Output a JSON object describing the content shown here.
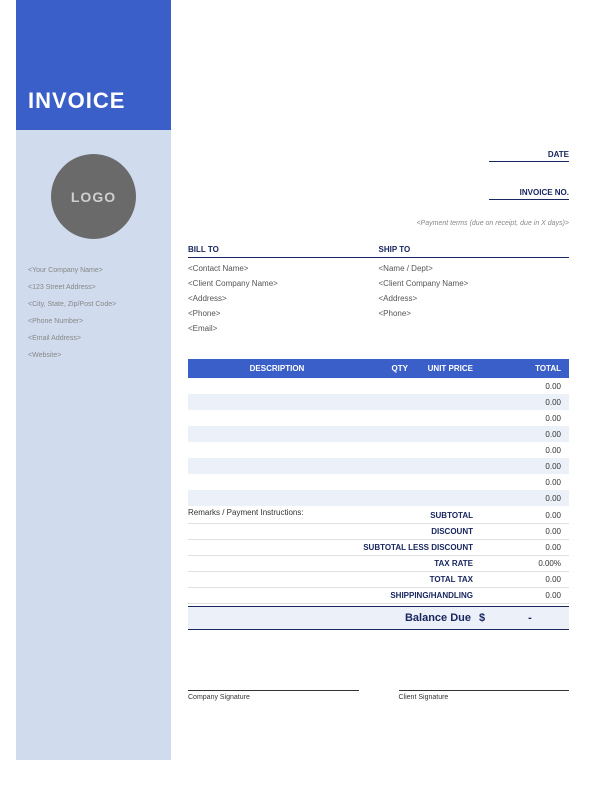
{
  "title": "INVOICE",
  "logo": "LOGO",
  "company": {
    "name": "<Your Company Name>",
    "address": "<123 Street Address>",
    "city": "<City, State, Zip/Post Code>",
    "phone": "<Phone Number>",
    "email": "<Email Address>",
    "website": "<Website>"
  },
  "meta": {
    "date_label": "DATE",
    "invoice_no_label": "INVOICE NO."
  },
  "payment_terms": "<Payment terms (due on receipt, due in X days)>",
  "bill_to": {
    "title": "BILL TO",
    "contact": "<Contact Name>",
    "company": "<Client Company Name>",
    "address": "<Address>",
    "phone": "<Phone>",
    "email": "<Email>"
  },
  "ship_to": {
    "title": "SHIP TO",
    "name": "<Name / Dept>",
    "company": "<Client Company Name>",
    "address": "<Address>",
    "phone": "<Phone>"
  },
  "table": {
    "headers": {
      "desc": "DESCRIPTION",
      "qty": "QTY",
      "price": "UNIT PRICE",
      "total": "TOTAL"
    },
    "rows": [
      {
        "desc": "",
        "qty": "",
        "price": "",
        "total": "0.00"
      },
      {
        "desc": "",
        "qty": "",
        "price": "",
        "total": "0.00"
      },
      {
        "desc": "",
        "qty": "",
        "price": "",
        "total": "0.00"
      },
      {
        "desc": "",
        "qty": "",
        "price": "",
        "total": "0.00"
      },
      {
        "desc": "",
        "qty": "",
        "price": "",
        "total": "0.00"
      },
      {
        "desc": "",
        "qty": "",
        "price": "",
        "total": "0.00"
      },
      {
        "desc": "",
        "qty": "",
        "price": "",
        "total": "0.00"
      },
      {
        "desc": "",
        "qty": "",
        "price": "",
        "total": "0.00"
      }
    ]
  },
  "remarks_label": "Remarks / Payment Instructions:",
  "totals": {
    "subtotal": {
      "label": "SUBTOTAL",
      "value": "0.00"
    },
    "discount": {
      "label": "DISCOUNT",
      "value": "0.00"
    },
    "subtotal_less": {
      "label": "SUBTOTAL LESS DISCOUNT",
      "value": "0.00"
    },
    "tax_rate": {
      "label": "TAX RATE",
      "value": "0.00%"
    },
    "total_tax": {
      "label": "TOTAL TAX",
      "value": "0.00"
    },
    "shipping": {
      "label": "SHIPPING/HANDLING",
      "value": "0.00"
    }
  },
  "balance": {
    "label": "Balance Due",
    "currency": "$",
    "value": "-"
  },
  "signatures": {
    "company": "Company Signature",
    "client": "Client Signature"
  }
}
